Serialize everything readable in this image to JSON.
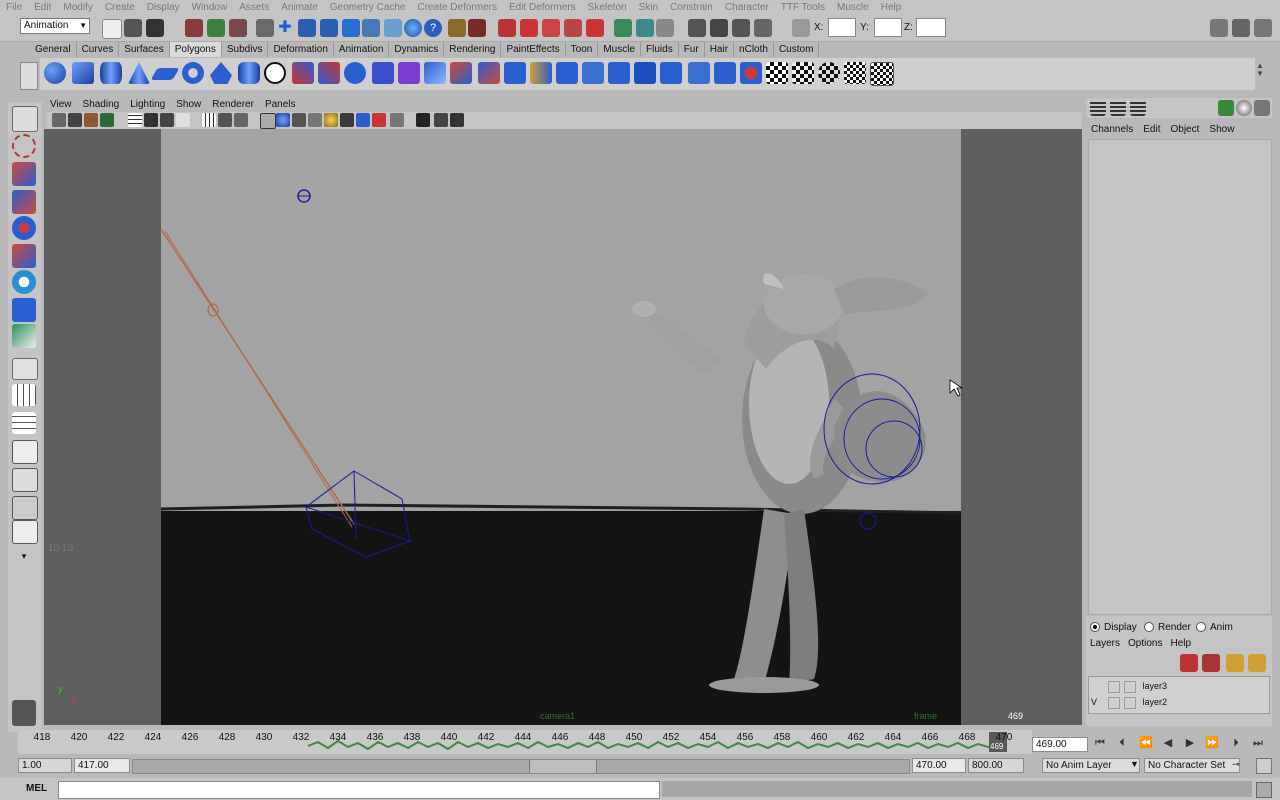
{
  "menus": [
    "File",
    "Edit",
    "Modify",
    "Create",
    "Display",
    "Window",
    "Assets",
    "Animate",
    "Geometry Cache",
    "Create Deformers",
    "Edit Deformers",
    "Skeleton",
    "Skin",
    "Constrain",
    "Character",
    "TTF Tools",
    "Muscle",
    "Help"
  ],
  "menu_set": "Animation",
  "status": {
    "x_label": "X:",
    "y_label": "Y:",
    "z_label": "Z:"
  },
  "shelf_tabs": [
    "General",
    "Curves",
    "Surfaces",
    "Polygons",
    "Subdivs",
    "Deformation",
    "Animation",
    "Dynamics",
    "Rendering",
    "PaintEffects",
    "Toon",
    "Muscle",
    "Fluids",
    "Fur",
    "Hair",
    "nCloth",
    "Custom"
  ],
  "shelf_selected": "Polygons",
  "panel_menus": [
    "View",
    "Shading",
    "Lighting",
    "Show",
    "Renderer",
    "Panels"
  ],
  "viewport": {
    "camera_name": "camera1",
    "frame_label": "frame",
    "frame_number": "469",
    "grid_label": "10 10",
    "axis_y": "y",
    "axis_x": "x"
  },
  "channel_box": {
    "menus": [
      "Channels",
      "Edit",
      "Object",
      "Show"
    ]
  },
  "layer_editor": {
    "modes": [
      "Display",
      "Render",
      "Anim"
    ],
    "selected_mode": "Display",
    "menus": [
      "Layers",
      "Options",
      "Help"
    ],
    "layers": [
      {
        "visible": "",
        "name": "layer3"
      },
      {
        "visible": "V",
        "name": "layer2"
      }
    ]
  },
  "timeline": {
    "ticks": [
      "418",
      "420",
      "422",
      "424",
      "426",
      "428",
      "430",
      "432",
      "434",
      "436",
      "438",
      "440",
      "442",
      "444",
      "446",
      "448",
      "450",
      "452",
      "454",
      "456",
      "458",
      "460",
      "462",
      "464",
      "466",
      "468",
      "470"
    ],
    "current_frame": "469.00",
    "playhead_marker": "469"
  },
  "range": {
    "start": "1.00",
    "range_start": "417.00",
    "range_end": "470.00",
    "end": "800.00",
    "anim_layer": "No Anim Layer",
    "character_set": "No Character Set"
  },
  "command_line": {
    "label": "MEL"
  },
  "colors": {
    "accent": "#1f5fd0",
    "wire": "#1a1a9a",
    "ground": "#141414",
    "backdrop": "#a3a3a3",
    "waveform": "#3f8a3f"
  }
}
